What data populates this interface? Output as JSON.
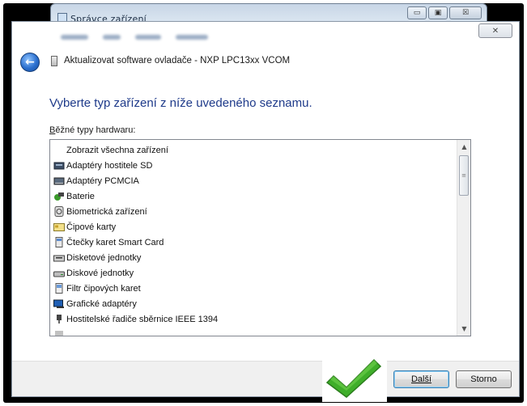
{
  "background_window": {
    "title": "Správce zařízení",
    "controls": [
      "▭",
      "▣",
      "☒"
    ]
  },
  "dialog": {
    "close_glyph": "✕",
    "header_title": "Aktualizovat software ovladače - NXP LPC13xx VCOM",
    "heading": "Vyberte typ zařízení z níže uvedeného seznamu.",
    "list_label": "Běžné typy hardwaru:",
    "list_items": [
      {
        "label": "Zobrazit všechna zařízení",
        "icon": "none"
      },
      {
        "label": "Adaptéry hostitele SD",
        "icon": "sd-host-adapter-icon"
      },
      {
        "label": "Adaptéry PCMCIA",
        "icon": "pcmcia-adapter-icon"
      },
      {
        "label": "Baterie",
        "icon": "battery-icon"
      },
      {
        "label": "Biometrická zařízení",
        "icon": "biometric-device-icon"
      },
      {
        "label": "Čipové karty",
        "icon": "smart-card-icon"
      },
      {
        "label": "Čtečky karet Smart Card",
        "icon": "smart-card-reader-icon"
      },
      {
        "label": "Disketové jednotky",
        "icon": "floppy-drive-icon"
      },
      {
        "label": "Diskové jednotky",
        "icon": "disk-drive-icon"
      },
      {
        "label": "Filtr čipových karet",
        "icon": "smart-card-filter-icon"
      },
      {
        "label": "Grafické adaptéry",
        "icon": "display-adapter-icon"
      },
      {
        "label": "Hostitelské řadiče sběrnice IEEE 1394",
        "icon": "ieee1394-controller-icon"
      }
    ],
    "buttons": {
      "next": "Další",
      "cancel": "Storno"
    }
  },
  "colors": {
    "heading": "#1e3a8a",
    "checkmark": "#3fae2a"
  }
}
